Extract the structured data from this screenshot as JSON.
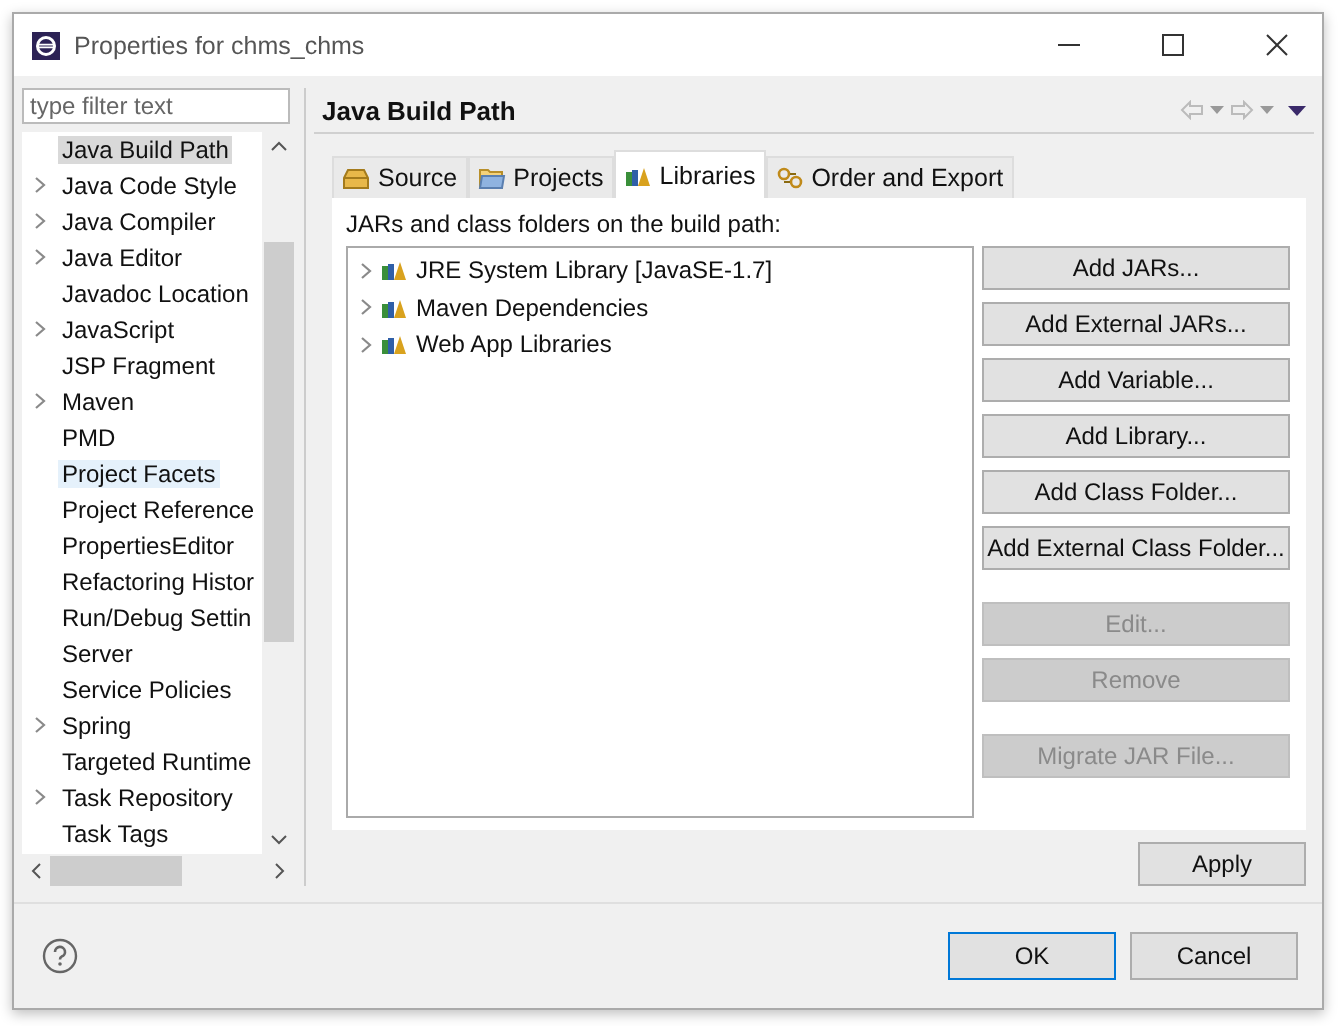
{
  "window": {
    "title": "Properties for chms_chms"
  },
  "sidebar": {
    "filter": {
      "placeholder": "type filter text"
    },
    "items": [
      {
        "label": "Java Build Path",
        "expandable": false,
        "selected": true,
        "hovered": false
      },
      {
        "label": "Java Code Style",
        "expandable": true,
        "selected": false,
        "hovered": false
      },
      {
        "label": "Java Compiler",
        "expandable": true,
        "selected": false,
        "hovered": false
      },
      {
        "label": "Java Editor",
        "expandable": true,
        "selected": false,
        "hovered": false
      },
      {
        "label": "Javadoc Location",
        "expandable": false,
        "selected": false,
        "hovered": false
      },
      {
        "label": "JavaScript",
        "expandable": true,
        "selected": false,
        "hovered": false
      },
      {
        "label": "JSP Fragment",
        "expandable": false,
        "selected": false,
        "hovered": false
      },
      {
        "label": "Maven",
        "expandable": true,
        "selected": false,
        "hovered": false
      },
      {
        "label": "PMD",
        "expandable": false,
        "selected": false,
        "hovered": false
      },
      {
        "label": "Project Facets",
        "expandable": false,
        "selected": false,
        "hovered": true
      },
      {
        "label": "Project Reference",
        "expandable": false,
        "selected": false,
        "hovered": false
      },
      {
        "label": "PropertiesEditor",
        "expandable": false,
        "selected": false,
        "hovered": false
      },
      {
        "label": "Refactoring Histor",
        "expandable": false,
        "selected": false,
        "hovered": false
      },
      {
        "label": "Run/Debug Settin",
        "expandable": false,
        "selected": false,
        "hovered": false
      },
      {
        "label": "Server",
        "expandable": false,
        "selected": false,
        "hovered": false
      },
      {
        "label": "Service Policies",
        "expandable": false,
        "selected": false,
        "hovered": false
      },
      {
        "label": "Spring",
        "expandable": true,
        "selected": false,
        "hovered": false
      },
      {
        "label": "Targeted Runtime",
        "expandable": false,
        "selected": false,
        "hovered": false
      },
      {
        "label": "Task Repository",
        "expandable": true,
        "selected": false,
        "hovered": false
      },
      {
        "label": "Task Tags",
        "expandable": false,
        "selected": false,
        "hovered": false
      }
    ]
  },
  "page": {
    "title": "Java Build Path",
    "tabs": [
      {
        "label": "Source",
        "kind": "source",
        "selected": false
      },
      {
        "label": "Projects",
        "kind": "projects",
        "selected": false
      },
      {
        "label": "Libraries",
        "kind": "libraries",
        "selected": true
      },
      {
        "label": "Order and Export",
        "kind": "order",
        "selected": false
      }
    ],
    "list_label": "JARs and class folders on the build path:",
    "entries": [
      {
        "label": "JRE System Library [JavaSE-1.7]",
        "expandable": true
      },
      {
        "label": "Maven Dependencies",
        "expandable": true
      },
      {
        "label": "Web App Libraries",
        "expandable": true
      }
    ],
    "button_groups": [
      [
        {
          "label": "Add JARs...",
          "disabled": false
        },
        {
          "label": "Add External JARs...",
          "disabled": false
        },
        {
          "label": "Add Variable...",
          "disabled": false
        },
        {
          "label": "Add Library...",
          "disabled": false
        },
        {
          "label": "Add Class Folder...",
          "disabled": false
        },
        {
          "label": "Add External Class Folder...",
          "disabled": false
        }
      ],
      [
        {
          "label": "Edit...",
          "disabled": true
        },
        {
          "label": "Remove",
          "disabled": true
        }
      ],
      [
        {
          "label": "Migrate JAR File...",
          "disabled": true
        }
      ]
    ],
    "apply": "Apply"
  },
  "footer": {
    "buttons": [
      {
        "label": "OK",
        "default": true
      },
      {
        "label": "Cancel",
        "default": false
      }
    ]
  }
}
